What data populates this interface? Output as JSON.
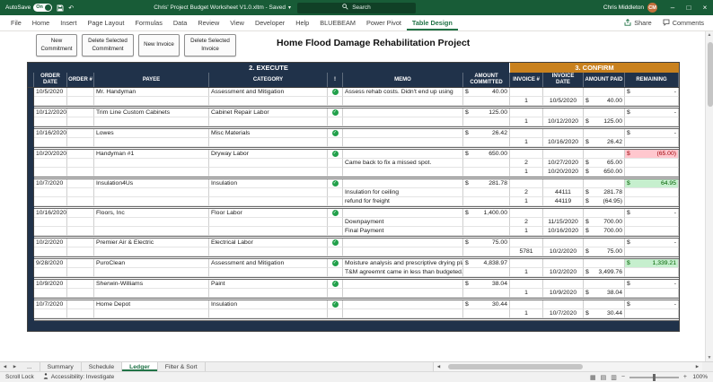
{
  "titlebar": {
    "autosave_label": "AutoSave",
    "autosave_state": "On",
    "doc_title": "Chris' Project Budget Worksheet V1.0.xltm - Saved",
    "search_placeholder": "Search",
    "user_name": "Chris Middleton",
    "user_initials": "CM"
  },
  "ribbon": {
    "tabs": [
      "File",
      "Home",
      "Insert",
      "Page Layout",
      "Formulas",
      "Data",
      "Review",
      "View",
      "Developer",
      "Help",
      "BLUEBEAM",
      "Power Pivot",
      "Table Design"
    ],
    "contextual_tab": "Table Design",
    "share_label": "Share",
    "comments_label": "Comments"
  },
  "toolbar_buttons": [
    "New Commitment",
    "Delete Selected Commitment",
    "New Invoice",
    "Delete Selected Invoice"
  ],
  "worksheet": {
    "title": "Home Flood Damage Rehabilitation Project",
    "section_execute": "2. EXECUTE",
    "section_confirm": "3. CONFIRM",
    "columns": [
      "ORDER DATE",
      "ORDER #",
      "PAYEE",
      "CATEGORY",
      "!",
      "MEMO",
      "AMOUNT COMMITTED",
      "INVOICE #",
      "INVOICE DATE",
      "AMOUNT PAID",
      "REMAINING"
    ],
    "colors": {
      "navy": "#20324A",
      "orange": "#C9811E",
      "check_green": "#21A04A",
      "negative_bg": "#FFC7CE",
      "negative_text": "#9C0006",
      "positive_bg": "#C6EFCE",
      "positive_text": "#006100"
    },
    "rows": [
      {
        "block_start": true,
        "date": "10/5/2020",
        "payee": "Mr. Handyman",
        "category": "Assessment and Mitigation",
        "check": true,
        "memo": "Assess rehab costs. Didn't end up using",
        "committed": "40.00",
        "remaining": "-"
      },
      {
        "invoice": "1",
        "invoice_date": "10/5/2020",
        "paid": "40.00"
      },
      {
        "type": "gap"
      },
      {
        "block_start": true,
        "date": "10/12/2020",
        "payee": "Trim Line Custom Cabinets",
        "category": "Cabinet Repair Labor",
        "check": true,
        "committed": "125.00",
        "remaining": "-"
      },
      {
        "invoice": "1",
        "invoice_date": "10/12/2020",
        "paid": "125.00"
      },
      {
        "type": "gap"
      },
      {
        "block_start": true,
        "date": "10/16/2020",
        "payee": "Lowes",
        "category": "Misc Materials",
        "check": true,
        "committed": "26.42",
        "remaining": "-"
      },
      {
        "invoice": "1",
        "invoice_date": "10/16/2020",
        "paid": "26.42"
      },
      {
        "type": "gap"
      },
      {
        "block_start": true,
        "date": "10/20/2020",
        "payee": "Handyman #1",
        "category": "Dryway Labor",
        "check": true,
        "committed": "650.00",
        "remaining": "(65.00)",
        "remaining_state": "neg"
      },
      {
        "memo": "Came back to fix a missed spot.",
        "invoice": "2",
        "invoice_date": "10/27/2020",
        "paid": "65.00"
      },
      {
        "invoice": "1",
        "invoice_date": "10/20/2020",
        "paid": "650.00"
      },
      {
        "type": "gap"
      },
      {
        "block_start": true,
        "date": "10/7/2020",
        "payee": "Insulation4Us",
        "category": "Insulation",
        "check": true,
        "committed": "281.78",
        "remaining": "64.95",
        "remaining_state": "pos"
      },
      {
        "memo": "Insulation for ceiling",
        "invoice": "2",
        "invoice_date": "44111",
        "paid": "281.78"
      },
      {
        "memo": "refund for freight",
        "invoice": "1",
        "invoice_date": "44119",
        "paid": "(64.95)"
      },
      {
        "type": "gap"
      },
      {
        "block_start": true,
        "date": "10/16/2020",
        "payee": "Floors, Inc",
        "category": "Floor Labor",
        "check": true,
        "committed": "1,400.00",
        "remaining": "-"
      },
      {
        "memo": "Downpayment",
        "invoice": "2",
        "invoice_date": "11/15/2020",
        "paid": "700.00"
      },
      {
        "memo": "Final Payment",
        "invoice": "1",
        "invoice_date": "10/16/2020",
        "paid": "700.00"
      },
      {
        "type": "gap"
      },
      {
        "block_start": true,
        "date": "10/2/2020",
        "payee": "Premier Air & Electric",
        "category": "Electrical Labor",
        "check": true,
        "committed": "75.00",
        "remaining": "-"
      },
      {
        "invoice": "5781",
        "invoice_date": "10/2/2020",
        "paid": "75.00"
      },
      {
        "type": "gap"
      },
      {
        "block_start": true,
        "date": "9/28/2020",
        "payee": "PuroClean",
        "category": "Assessment and Mitigation",
        "check": true,
        "memo": "Moisture analysis and prescriptive drying plan",
        "committed": "4,838.97",
        "remaining": "1,339.21",
        "remaining_state": "pos"
      },
      {
        "memo": "T&M agreemnt came in less than budgeted.",
        "invoice": "1",
        "invoice_date": "10/2/2020",
        "paid": "3,499.76"
      },
      {
        "type": "gap"
      },
      {
        "block_start": true,
        "date": "10/9/2020",
        "payee": "Sherwin-Williams",
        "category": "Paint",
        "check": true,
        "committed": "38.04",
        "remaining": "-"
      },
      {
        "invoice": "1",
        "invoice_date": "10/9/2020",
        "paid": "38.04"
      },
      {
        "type": "gap"
      },
      {
        "block_start": true,
        "date": "10/7/2020",
        "payee": "Home Depot",
        "category": "Insulation",
        "check": true,
        "committed": "30.44",
        "remaining": "-"
      },
      {
        "invoice": "1",
        "invoice_date": "10/7/2020",
        "paid": "30.44"
      },
      {
        "type": "gap"
      },
      {
        "type": "footer"
      }
    ]
  },
  "sheet_tabs": {
    "tabs": [
      "...",
      "Summary",
      "Schedule",
      "Ledger",
      "Filter & Sort"
    ],
    "active": "Ledger"
  },
  "status_bar": {
    "left": "Scroll Lock",
    "accessibility": "Accessibility: Investigate",
    "zoom": "100%"
  },
  "icons": {
    "caret_down": "▾",
    "minimize": "–",
    "maximize": "□",
    "close": "×",
    "undo": "↶",
    "scroll_up": "▲",
    "scroll_down": "▼",
    "nav_prev": "◀",
    "nav_next": "▶",
    "view_normal": "▦",
    "view_page_layout": "▤",
    "view_page_break": "▥",
    "zoom_out": "−",
    "zoom_in": "+",
    "check": "✓"
  }
}
